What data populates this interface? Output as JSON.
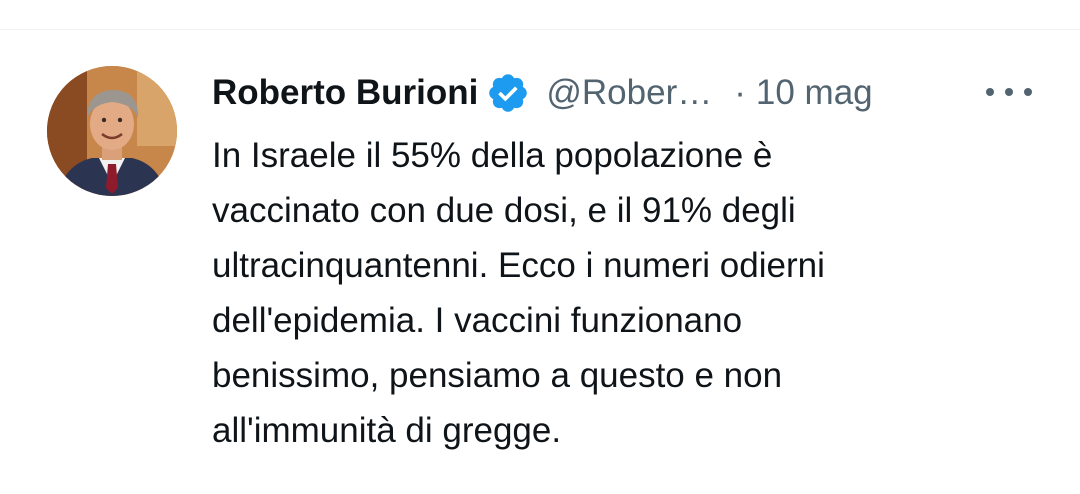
{
  "tweet": {
    "author": {
      "name": "Roberto Burioni",
      "handle": "@Rober…",
      "verified": true,
      "avatar_icon": "profile-photo"
    },
    "separator": "·",
    "timestamp": "10 mag",
    "more_icon": "more-horizontal-icon",
    "text_lines": [
      "In Israele il 55% della popolazione è",
      "vaccinato con due dosi, e il 91% degli",
      "ultracinquantenni. Ecco i numeri odierni",
      "dell'epidemia. I vaccini funzionano",
      "benissimo, pensiamo a questo e non",
      "all'immunità di gregge."
    ],
    "colors": {
      "primary_text": "#0f1419",
      "secondary_text": "#536471",
      "verified_badge": "#1d9bf0"
    }
  }
}
